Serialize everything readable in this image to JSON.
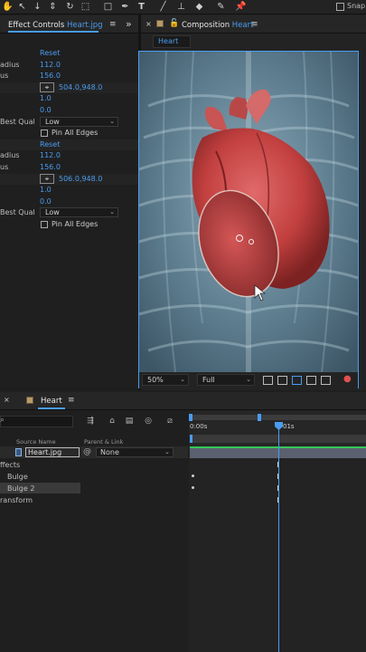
{
  "toolbar": {
    "tools": [
      "pan-icon",
      "select-icon",
      "rotate-icon",
      "camera-icon",
      "shape-icon",
      "pen-icon",
      "text-icon",
      "brush-icon",
      "stamp-icon",
      "eraser-icon",
      "roto-icon",
      "pin-icon"
    ],
    "snap_label": "Snap"
  },
  "effect_controls": {
    "tab_label_prefix": "Effect Controls ",
    "tab_label_file": "Heart.jpg",
    "rows": [
      {
        "label": "",
        "value": "Reset",
        "kind": "blue"
      },
      {
        "label": "adius",
        "value": "112.0",
        "kind": "blue"
      },
      {
        "label": "us",
        "value": "156.0",
        "kind": "blue"
      },
      {
        "label": "",
        "value": "504.0,948.0",
        "kind": "point"
      },
      {
        "label": "",
        "value": "1.0",
        "kind": "blue"
      },
      {
        "label": "",
        "value": "0.0",
        "kind": "blue"
      },
      {
        "label": "Best Qual",
        "value": "Low",
        "kind": "dropdown"
      },
      {
        "label": "",
        "value": "Pin All Edges",
        "kind": "checkbox"
      },
      {
        "label": "",
        "value": "Reset",
        "kind": "blue"
      },
      {
        "label": "adius",
        "value": "112.0",
        "kind": "blue"
      },
      {
        "label": "us",
        "value": "156.0",
        "kind": "blue"
      },
      {
        "label": "",
        "value": "506.0,948.0",
        "kind": "point"
      },
      {
        "label": "",
        "value": "1.0",
        "kind": "blue"
      },
      {
        "label": "",
        "value": "0.0",
        "kind": "blue"
      },
      {
        "label": "Best Qual",
        "value": "Low",
        "kind": "dropdown"
      },
      {
        "label": "",
        "value": "Pin All Edges",
        "kind": "checkbox"
      }
    ]
  },
  "composition": {
    "tab_label_prefix": "Composition ",
    "tab_label_name": "Heart",
    "subtab": "Heart",
    "zoom": "50%",
    "resolution": "Full"
  },
  "timeline": {
    "tab_label": "Heart",
    "columns": {
      "source": "Source Name",
      "parent": "Parent & Link"
    },
    "layer": {
      "name": "Heart.jpg",
      "parent": "None"
    },
    "props": [
      {
        "label": "ffects"
      },
      {
        "label": "Bulge"
      },
      {
        "label": "Bulge 2"
      },
      {
        "label": "ransform"
      }
    ],
    "ruler": {
      "start": "0:00s",
      "mark": "01s"
    }
  }
}
